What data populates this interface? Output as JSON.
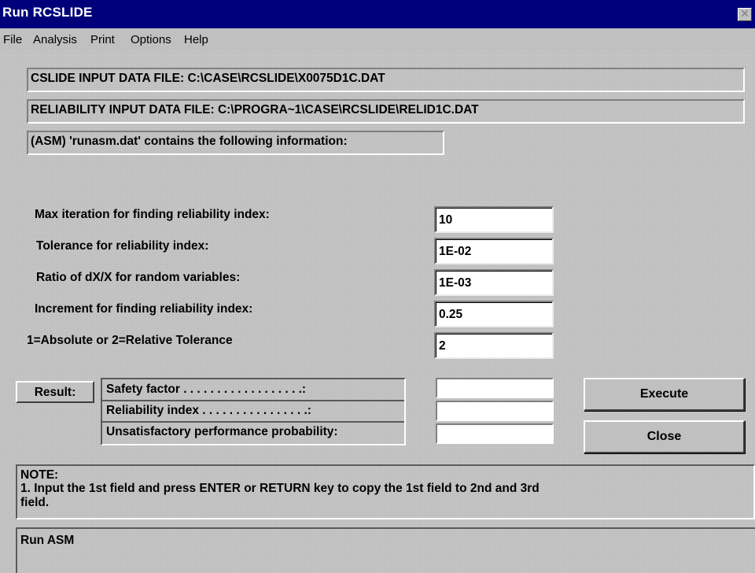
{
  "window": {
    "title": "Run RCSLIDE",
    "close_glyph": "✕"
  },
  "menu": [
    "File",
    "Analysis",
    "Print",
    "Options",
    "Help"
  ],
  "files": {
    "cslide": "CSLIDE INPUT DATA FILE: C:\\CASE\\RCSLIDE\\X0075D1C.DAT",
    "reliability": "RELIABILITY INPUT DATA FILE: C:\\PROGRA~1\\CASE\\RCSLIDE\\RELID1C.DAT",
    "asm_info": "(ASM) 'runasm.dat' contains the following information:"
  },
  "params": [
    {
      "label": "Max iteration for finding reliability index:",
      "value": "10"
    },
    {
      "label": "Tolerance for reliability index:",
      "value": "1E-02"
    },
    {
      "label": "Ratio of dX/X for random variables:",
      "value": "1E-03"
    },
    {
      "label": "Increment for finding reliability index:",
      "value": "0.25"
    },
    {
      "label": "1=Absolute or 2=Relative Tolerance",
      "value": "2"
    }
  ],
  "result": {
    "label": "Result:",
    "rows": [
      {
        "label": "Safety factor . . . . . . . . . . . . . . . . . .:",
        "value": ""
      },
      {
        "label": "Reliability index . . . . . . . . . . . . . . . .:",
        "value": ""
      },
      {
        "label": "Unsatisfactory performance probability:",
        "value": ""
      }
    ]
  },
  "buttons": {
    "execute": "Execute",
    "close": "Close"
  },
  "note": {
    "heading": "NOTE:",
    "line1": "1. Input the 1st field and press ENTER or RETURN key to copy the 1st field to 2nd and 3rd",
    "line2": "field."
  },
  "status": "Run ASM"
}
